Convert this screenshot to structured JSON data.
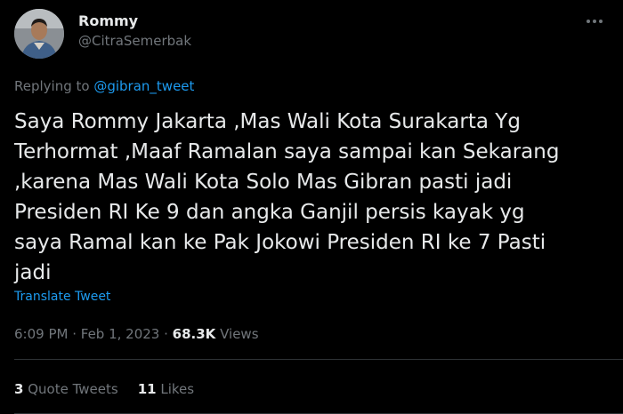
{
  "user": {
    "display_name": "Rommy",
    "handle": "@CitraSemerbak",
    "avatar_icon": "user-photo-avatar"
  },
  "reply": {
    "prefix": "Replying to ",
    "target": "@gibran_tweet"
  },
  "tweet": {
    "text": "Saya Rommy Jakarta ,Mas Wali Kota Surakarta Yg\nTerhormat ,Maaf Ramalan saya sampai kan Sekarang\n,karena Mas Wali Kota Solo Mas Gibran pasti jadi\nPresiden RI Ke 9 dan angka Ganjil persis kayak yg\nsaya Ramal kan ke Pak Jokowi Presiden RI ke 7 Pasti\njadi",
    "translate_label": "Translate Tweet"
  },
  "meta": {
    "time": "6:09 PM",
    "separator": " · ",
    "date": "Feb 1, 2023",
    "views_count": "68.3K",
    "views_label": "Views"
  },
  "stats": {
    "quote_count": "3",
    "quote_label": "Quote Tweets",
    "likes_count": "11",
    "likes_label": "Likes"
  },
  "icons": {
    "more": "more-horizontal-icon"
  },
  "colors": {
    "background": "#000000",
    "text_primary": "#e7e9ea",
    "text_secondary": "#71767b",
    "link": "#1d9bf0",
    "divider": "#2f3336"
  }
}
